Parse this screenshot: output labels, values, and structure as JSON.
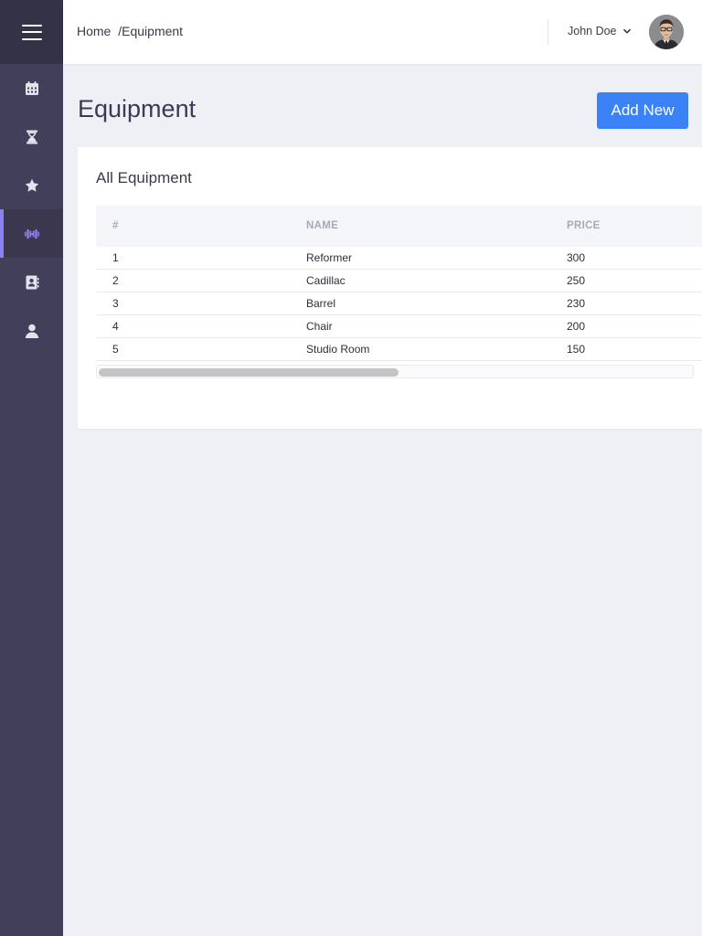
{
  "header": {
    "breadcrumb_home": "Home",
    "breadcrumb_current": "/Equipment",
    "user_name": "John Doe"
  },
  "sidebar": {
    "items": [
      {
        "icon": "calendar-icon",
        "active": false
      },
      {
        "icon": "hourglass-icon",
        "active": false
      },
      {
        "icon": "star-icon",
        "active": false
      },
      {
        "icon": "dumbbell-icon",
        "active": true
      },
      {
        "icon": "contact-book-icon",
        "active": false
      },
      {
        "icon": "user-icon",
        "active": false
      }
    ]
  },
  "main": {
    "title": "Equipment",
    "add_button": "Add New",
    "card_title": "All Equipment",
    "table": {
      "headers": [
        "#",
        "NAME",
        "PRICE"
      ],
      "rows": [
        [
          "1",
          "Reformer",
          "300"
        ],
        [
          "2",
          "Cadillac",
          "250"
        ],
        [
          "3",
          "Barrel",
          "230"
        ],
        [
          "4",
          "Chair",
          "200"
        ],
        [
          "5",
          "Studio Room",
          "150"
        ]
      ]
    }
  },
  "colors": {
    "sidebar": "#423f5a",
    "sidebar_top": "#343247",
    "accent": "#8c80f0",
    "primary_button": "#3b82f6",
    "page_background": "#eff0f5"
  }
}
